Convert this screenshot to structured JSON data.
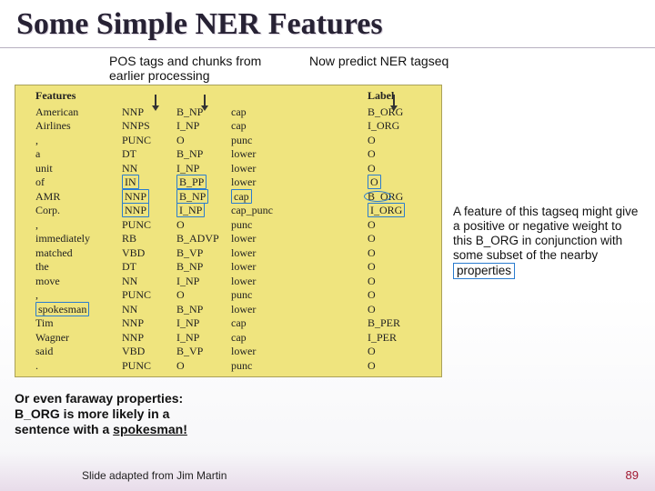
{
  "title": "Some Simple NER Features",
  "anno_left": "POS tags and chunks from earlier processing",
  "anno_right": "Now predict NER tagseq",
  "columns": [
    "Features",
    "",
    "",
    "",
    "",
    "Label"
  ],
  "rows": [
    {
      "w": "American",
      "pos": "NNP",
      "chunk": "B_NP",
      "feat": "cap",
      "lab": "B_ORG",
      "hl_pos": false,
      "hl_chunk": false,
      "hl_feat": false,
      "hl_lab": false,
      "hl_w": false
    },
    {
      "w": "Airlines",
      "pos": "NNPS",
      "chunk": "I_NP",
      "feat": "cap",
      "lab": "I_ORG",
      "hl_pos": false,
      "hl_chunk": false,
      "hl_feat": false,
      "hl_lab": false,
      "hl_w": false
    },
    {
      "w": ",",
      "pos": "PUNC",
      "chunk": "O",
      "feat": "punc",
      "lab": "O",
      "hl_pos": false,
      "hl_chunk": false,
      "hl_feat": false,
      "hl_lab": false,
      "hl_w": false
    },
    {
      "w": "a",
      "pos": "DT",
      "chunk": "B_NP",
      "feat": "lower",
      "lab": "O",
      "hl_pos": false,
      "hl_chunk": false,
      "hl_feat": false,
      "hl_lab": false,
      "hl_w": false
    },
    {
      "w": "unit",
      "pos": "NN",
      "chunk": "I_NP",
      "feat": "lower",
      "lab": "O",
      "hl_pos": false,
      "hl_chunk": false,
      "hl_feat": false,
      "hl_lab": false,
      "hl_w": false
    },
    {
      "w": "of",
      "pos": "IN",
      "chunk": "B_PP",
      "feat": "lower",
      "lab": "O",
      "hl_pos": true,
      "hl_chunk": true,
      "hl_feat": false,
      "hl_lab": true,
      "hl_w": false
    },
    {
      "w": "AMR",
      "pos": "NNP",
      "chunk": "B_NP",
      "feat": "cap",
      "lab": "B_ORG",
      "hl_pos": true,
      "hl_chunk": true,
      "hl_feat": true,
      "hl_lab": false,
      "hl_w": false,
      "oval_lab": true
    },
    {
      "w": "Corp.",
      "pos": "NNP",
      "chunk": "I_NP",
      "feat": "cap_punc",
      "lab": "I_ORG",
      "hl_pos": true,
      "hl_chunk": true,
      "hl_feat": false,
      "hl_lab": true,
      "hl_w": false
    },
    {
      "w": ",",
      "pos": "PUNC",
      "chunk": "O",
      "feat": "punc",
      "lab": "O",
      "hl_pos": false,
      "hl_chunk": false,
      "hl_feat": false,
      "hl_lab": false,
      "hl_w": false
    },
    {
      "w": "immediately",
      "pos": "RB",
      "chunk": "B_ADVP",
      "feat": "lower",
      "lab": "O",
      "hl_pos": false,
      "hl_chunk": false,
      "hl_feat": false,
      "hl_lab": false,
      "hl_w": false
    },
    {
      "w": "matched",
      "pos": "VBD",
      "chunk": "B_VP",
      "feat": "lower",
      "lab": "O",
      "hl_pos": false,
      "hl_chunk": false,
      "hl_feat": false,
      "hl_lab": false,
      "hl_w": false
    },
    {
      "w": "the",
      "pos": "DT",
      "chunk": "B_NP",
      "feat": "lower",
      "lab": "O",
      "hl_pos": false,
      "hl_chunk": false,
      "hl_feat": false,
      "hl_lab": false,
      "hl_w": false
    },
    {
      "w": "move",
      "pos": "NN",
      "chunk": "I_NP",
      "feat": "lower",
      "lab": "O",
      "hl_pos": false,
      "hl_chunk": false,
      "hl_feat": false,
      "hl_lab": false,
      "hl_w": false
    },
    {
      "w": ",",
      "pos": "PUNC",
      "chunk": "O",
      "feat": "punc",
      "lab": "O",
      "hl_pos": false,
      "hl_chunk": false,
      "hl_feat": false,
      "hl_lab": false,
      "hl_w": false
    },
    {
      "w": "spokesman",
      "pos": "NN",
      "chunk": "B_NP",
      "feat": "lower",
      "lab": "O",
      "hl_pos": false,
      "hl_chunk": false,
      "hl_feat": false,
      "hl_lab": false,
      "hl_w": true
    },
    {
      "w": "Tim",
      "pos": "NNP",
      "chunk": "I_NP",
      "feat": "cap",
      "lab": "B_PER",
      "hl_pos": false,
      "hl_chunk": false,
      "hl_feat": false,
      "hl_lab": false,
      "hl_w": false
    },
    {
      "w": "Wagner",
      "pos": "NNP",
      "chunk": "I_NP",
      "feat": "cap",
      "lab": "I_PER",
      "hl_pos": false,
      "hl_chunk": false,
      "hl_feat": false,
      "hl_lab": false,
      "hl_w": false
    },
    {
      "w": "said",
      "pos": "VBD",
      "chunk": "B_VP",
      "feat": "lower",
      "lab": "O",
      "hl_pos": false,
      "hl_chunk": false,
      "hl_feat": false,
      "hl_lab": false,
      "hl_w": false
    },
    {
      "w": ".",
      "pos": "PUNC",
      "chunk": "O",
      "feat": "punc",
      "lab": "O",
      "hl_pos": false,
      "hl_chunk": false,
      "hl_feat": false,
      "hl_lab": false,
      "hl_w": false
    }
  ],
  "side_note": {
    "text": "A feature of this tagseq might give a positive or negative weight to this B_ORG in conjunction with some subset of the nearby",
    "boxed_suffix": "properties"
  },
  "bottom_note": {
    "line1": "Or even faraway properties:",
    "line2": "B_ORG is more likely in a",
    "line3_plain": "sentence with a ",
    "line3_ul": "spokesman!"
  },
  "credit": "Slide adapted from Jim Martin",
  "page_number": "89"
}
